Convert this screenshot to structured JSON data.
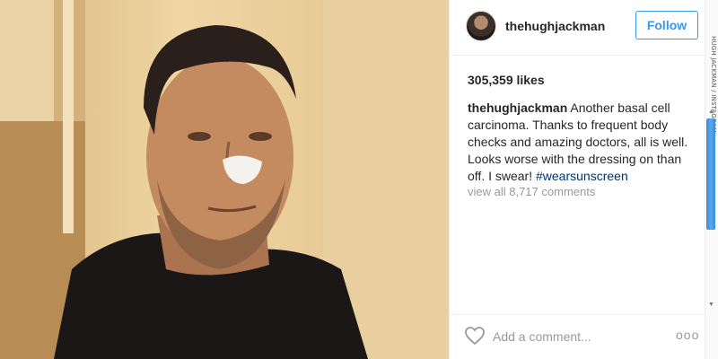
{
  "post": {
    "image_description_alt": "",
    "username": "thehughjackman",
    "follow_label": "Follow",
    "likes": "305,359 likes",
    "caption_user": "thehughjackman",
    "caption_text": " Another basal cell carcinoma. Thanks to frequent body checks and amazing doctors, all is well. Looks worse with the dressing on than off. I swear! ",
    "hashtag": "#wearsunscreen",
    "view_all": "view all 8,717 comments",
    "comment_placeholder": "Add a comment...",
    "more_label": "ooo"
  },
  "credit": "HUGH JACKMAN / INSTAGRAM",
  "colors": {
    "accent": "#3897f0",
    "hashtag": "#003569",
    "muted": "#999999",
    "scroll_thumb": "#4a9be6"
  },
  "icons": {
    "like": "heart-outline-icon",
    "more": "ellipsis-icon"
  }
}
